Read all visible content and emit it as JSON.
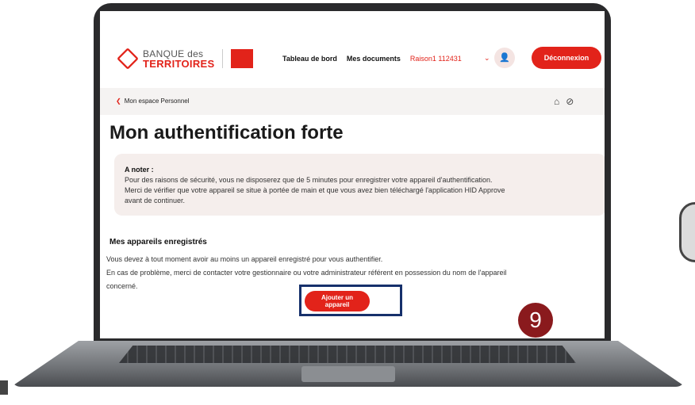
{
  "header": {
    "logo_line1": "BANQUE des",
    "logo_line2": "TERRITOIRES",
    "nav_dashboard": "Tableau de bord",
    "nav_documents": "Mes documents",
    "user_name": "Raison1 112431",
    "logout_label": "Déconnexion"
  },
  "breadcrumb": {
    "label": "Mon espace Personnel"
  },
  "page": {
    "title": "Mon authentification forte"
  },
  "notice": {
    "title": "A noter :",
    "line1": "Pour des raisons de sécurité, vous ne disposerez que de 5 minutes pour enregistrer votre appareil d'authentification.",
    "line2": "Merci de vérifier que votre appareil se situe à portée de main et que vous avez bien téléchargé l'application HID Approve",
    "line3": "avant de continuer."
  },
  "devices": {
    "section_title": "Mes appareils enregistrés",
    "line1": "Vous devez à tout moment avoir au moins un appareil enregistré pour vous authentifier.",
    "line2": "En cas de problème, merci de contacter votre gestionnaire ou votre administrateur référent en possession du nom de l'appareil",
    "line3": "concerné.",
    "add_button": "Ajouter un appareil"
  },
  "annotation": {
    "step_number": "9"
  },
  "colors": {
    "brand_red": "#e2231a",
    "highlight_border": "#16306b",
    "badge": "#8a1a1d"
  },
  "icons": {
    "user": "user-icon",
    "home_settings": "home-settings-icon",
    "hide": "eye-off-icon"
  }
}
